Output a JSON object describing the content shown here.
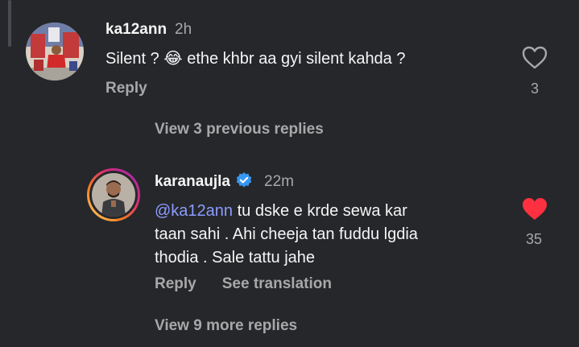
{
  "comment1": {
    "username": "ka12ann",
    "time": "2h",
    "text_before": "Silent ? ",
    "emoji": "😂",
    "text_after": " ethe khbr aa gyi silent kahda ?",
    "reply_label": "Reply",
    "likes": "3"
  },
  "view_previous": "View 3 previous replies",
  "comment2": {
    "username": "karanaujla",
    "time": "22m",
    "mention": "@ka12ann",
    "line1_rest": " tu dske e krde sewa kar",
    "line2": "taan sahi . Ahi cheeja tan fuddu lgdia",
    "line3": "thodia . Sale tattu jahe",
    "reply_label": "Reply",
    "translation_label": "See translation",
    "likes": "35"
  },
  "view_more": "View 9 more replies",
  "colors": {
    "background": "#26272b",
    "mention": "#8b9cff",
    "liked_heart": "#ff3040",
    "verified": "#3897f0"
  }
}
